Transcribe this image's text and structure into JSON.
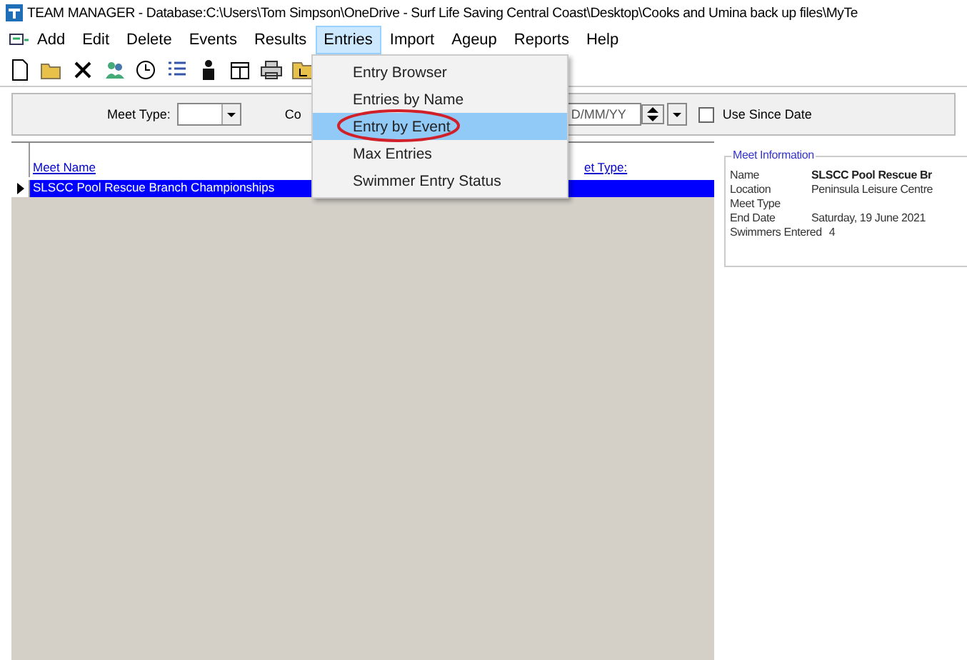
{
  "window": {
    "title": "TEAM MANAGER - Database:C:\\Users\\Tom Simpson\\OneDrive - Surf Life Saving Central Coast\\Desktop\\Cooks and Umina back up files\\MyTe"
  },
  "menu_bar": [
    {
      "label": "Add",
      "selected": false
    },
    {
      "label": "Edit",
      "selected": false
    },
    {
      "label": "Delete",
      "selected": false
    },
    {
      "label": "Events",
      "selected": false
    },
    {
      "label": "Results",
      "selected": false
    },
    {
      "label": "Entries",
      "selected": true
    },
    {
      "label": "Import",
      "selected": false
    },
    {
      "label": "Ageup",
      "selected": false
    },
    {
      "label": "Reports",
      "selected": false
    },
    {
      "label": "Help",
      "selected": false
    }
  ],
  "toolbar": [
    {
      "kind": "new"
    },
    {
      "kind": "open"
    },
    {
      "kind": "delete"
    },
    {
      "kind": "people"
    },
    {
      "kind": "clock"
    },
    {
      "kind": "list"
    },
    {
      "kind": "person"
    },
    {
      "kind": "calendar"
    },
    {
      "kind": "print"
    },
    {
      "kind": "folder"
    }
  ],
  "dropdown_menu": [
    {
      "label": "Entry Browser",
      "selected": false,
      "circled": false
    },
    {
      "label": "Entries by Name",
      "selected": false,
      "circled": false
    },
    {
      "label": "Entry by Event",
      "selected": true,
      "circled": true
    },
    {
      "label": "Max Entries",
      "selected": false,
      "circled": false
    },
    {
      "label": "Swimmer Entry Status",
      "selected": false,
      "circled": false
    }
  ],
  "filters": {
    "meet_type_label": "Meet Type:",
    "column_label": "Co",
    "date_field": {
      "value": "D/MM/YY"
    },
    "use_since_date": {
      "label": "Use Since Date",
      "checked": false
    }
  },
  "table": {
    "columns": [
      "Meet Name",
      "et Type:"
    ],
    "rows": [
      {
        "cells": [
          "SLSCC Pool Rescue Branch Championships",
          ""
        ],
        "selected": true
      }
    ]
  },
  "meet_information": {
    "title": "Meet Information",
    "fields": [
      {
        "label": "Name",
        "value": "SLSCC Pool Rescue Br",
        "bold": true
      },
      {
        "label": "Location",
        "value": "Peninsula Leisure Centre",
        "bold": false
      },
      {
        "label": "Meet Type"
      },
      {
        "label": "End Date",
        "value": "Saturday, 19 June 2021",
        "bold": false
      },
      {
        "label": "Swimmers Entered",
        "value": "4",
        "bold": false
      }
    ]
  }
}
